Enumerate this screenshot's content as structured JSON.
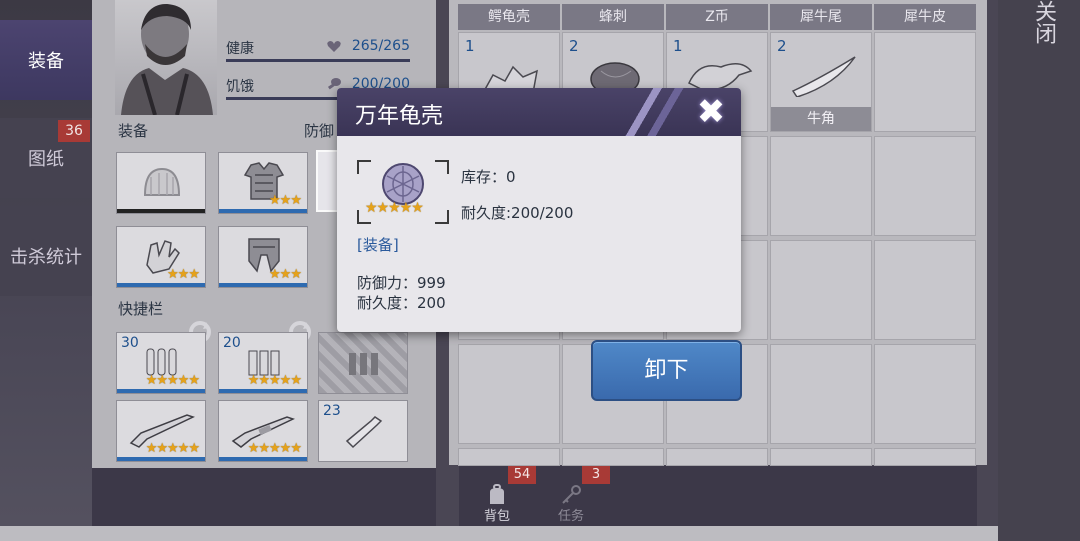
{
  "left_tabs": [
    {
      "label": "装备",
      "active": true
    },
    {
      "label": "图纸",
      "badge": "36"
    },
    {
      "label": "击杀统计"
    }
  ],
  "character": {
    "stats": [
      {
        "label": "健康",
        "icon": "heart-icon",
        "value": "265/265"
      },
      {
        "label": "饥饿",
        "icon": "drumstick-icon",
        "value": "200/200"
      }
    ]
  },
  "equipment": {
    "section_label": "装备",
    "defense_label": "防御",
    "slots": [
      {
        "item": "knit-cap",
        "stars": ""
      },
      {
        "item": "armor-vest",
        "stars": "★★★"
      },
      {
        "item": "turtle-shell",
        "stars": "★★★★★"
      },
      {
        "item": "gloves",
        "stars": "★★★"
      },
      {
        "item": "armor-pants",
        "stars": "★★★"
      }
    ]
  },
  "quickbar": {
    "label": "快捷栏",
    "slots": [
      {
        "count": "30",
        "item": "rifle-ammo",
        "stars": "★★★★★"
      },
      {
        "count": "20",
        "item": "shotgun-shells",
        "stars": "★★★★★"
      },
      {
        "count": "",
        "item": "locked",
        "stars": ""
      },
      {
        "count": "",
        "item": "rifle",
        "stars": "★★★★★"
      },
      {
        "count": "",
        "item": "shotgun",
        "stars": "★★★★★"
      },
      {
        "count": "23",
        "item": "bottle",
        "stars": ""
      }
    ]
  },
  "inventory": {
    "columns": [
      "鳄龟壳",
      "蜂刺",
      "Z币",
      "犀牛尾",
      "犀牛皮"
    ],
    "items": [
      {
        "count": "1",
        "icon": "shell-fragments-icon"
      },
      {
        "count": "2",
        "icon": "meat-icon"
      },
      {
        "count": "1",
        "icon": "pelt-icon"
      },
      {
        "count": "2",
        "icon": "horn-icon",
        "name": "牛角"
      }
    ]
  },
  "popup": {
    "title": "万年龟壳",
    "stars": "★★★★★",
    "stock": "库存：0",
    "durability": "耐久度:200/200",
    "tag": "[装备]",
    "defense": "防御力：999",
    "durability2": "耐久度：200"
  },
  "actions": {
    "unequip": "卸下"
  },
  "bottom_tabs": [
    {
      "label": "背包",
      "badge": "54",
      "icon": "backpack-icon"
    },
    {
      "label": "任务",
      "badge": "3",
      "icon": "key-icon"
    }
  ],
  "close_label": "关闭",
  "colors": {
    "accent": "#3a6aad",
    "badge": "#a83a36",
    "header": "#3a3455",
    "star": "#e6a21a"
  }
}
